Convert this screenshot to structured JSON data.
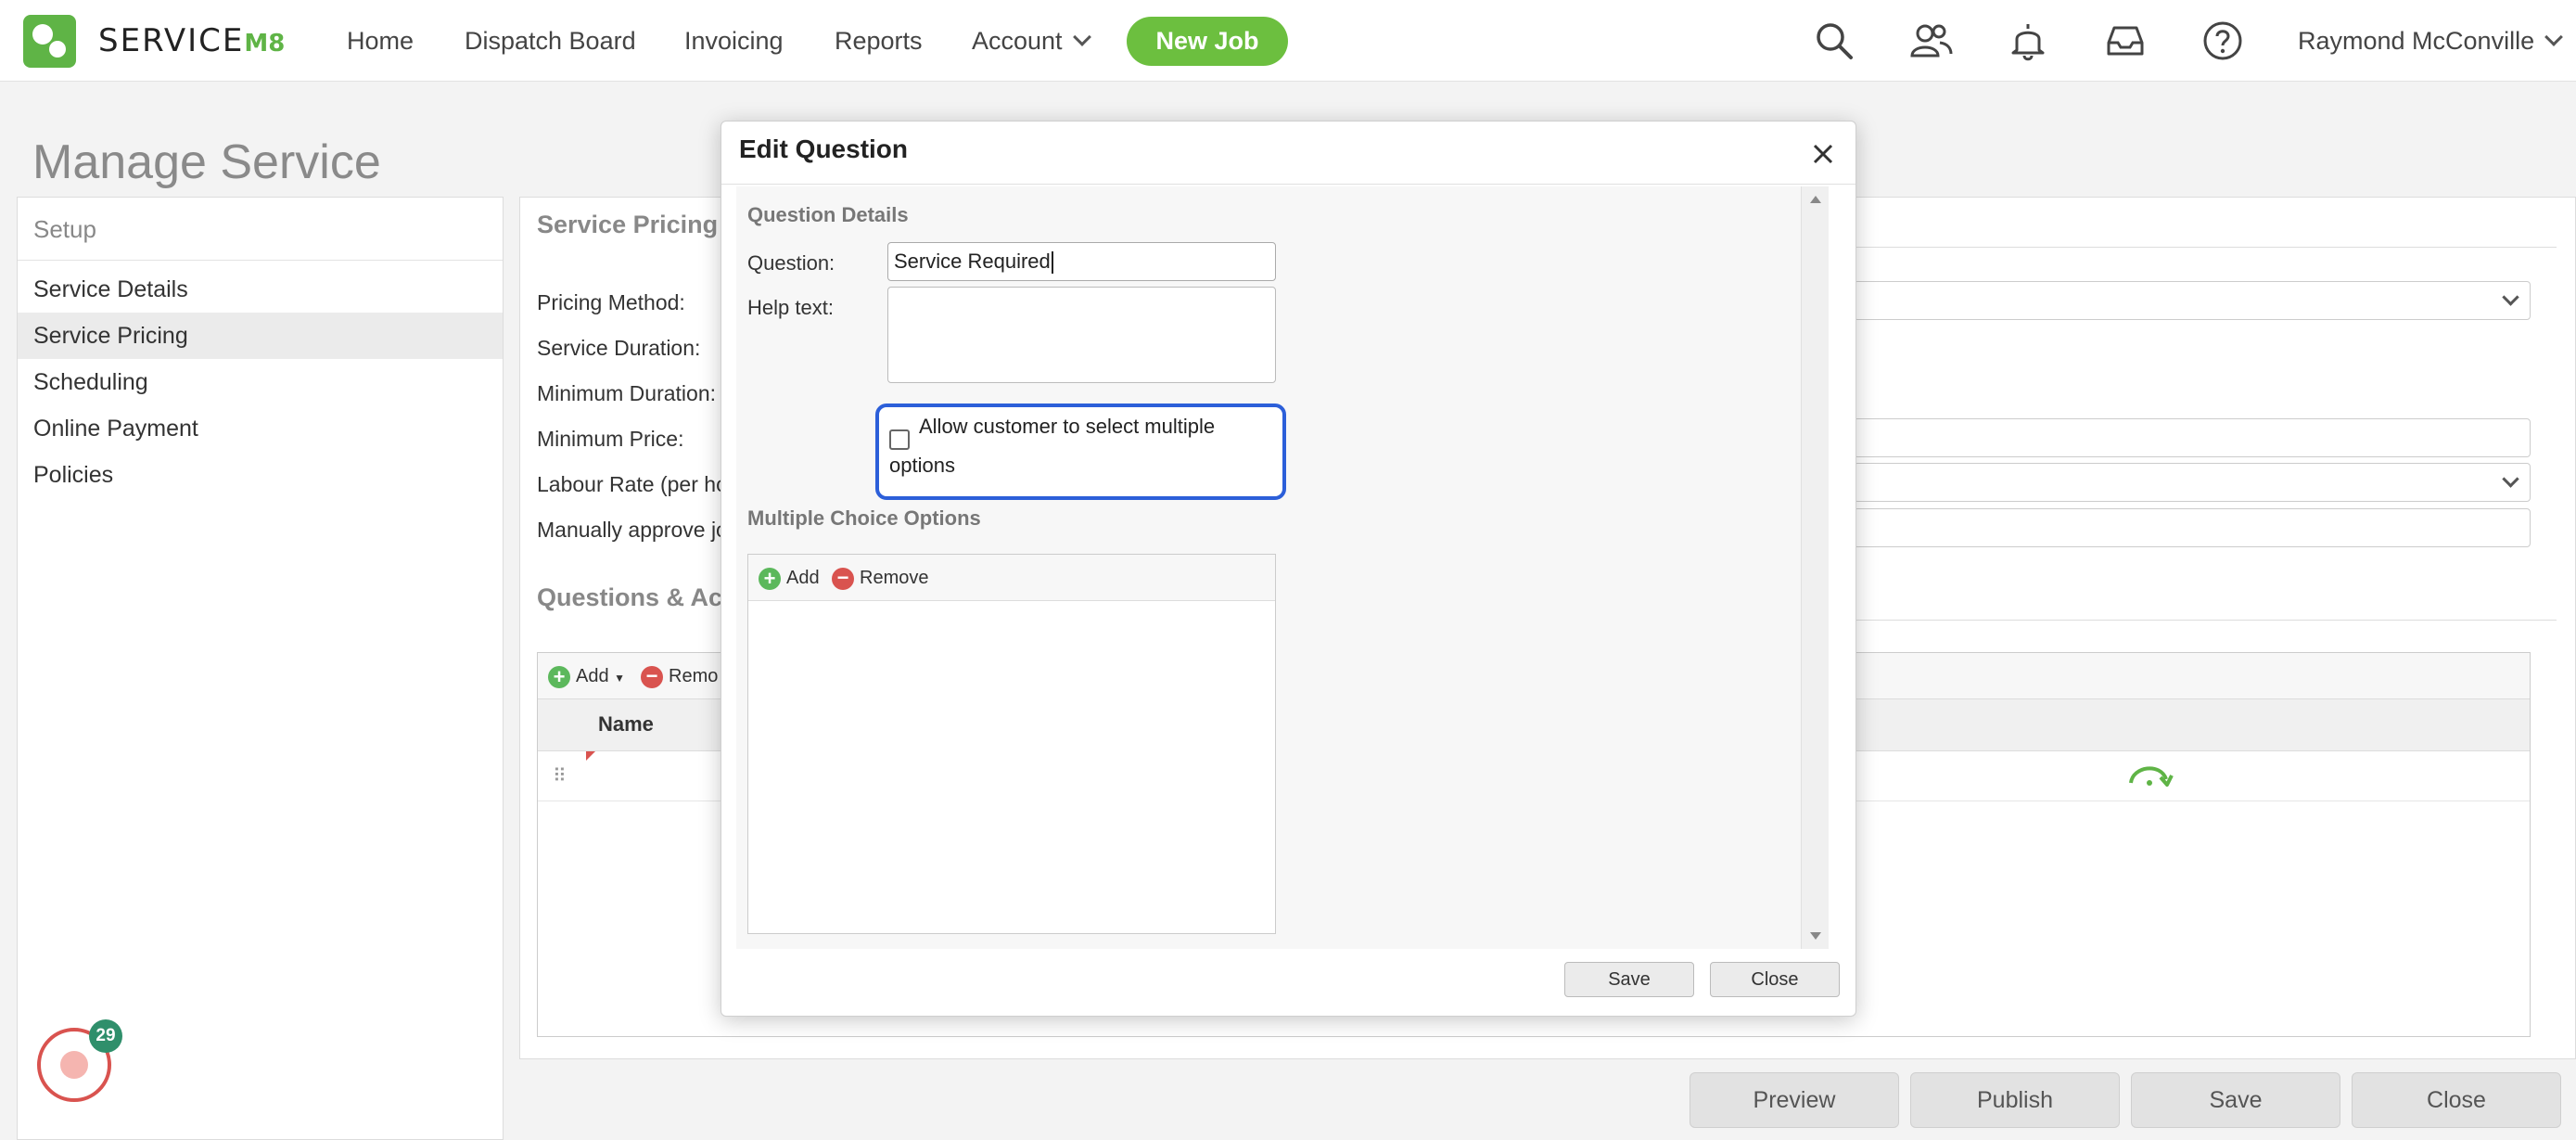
{
  "brand": {
    "name_main": "SERVICE",
    "name_suffix": "M8",
    "accent": "#6cbf3f"
  },
  "nav": {
    "items": [
      "Home",
      "Dispatch Board",
      "Invoicing",
      "Reports",
      "Account"
    ],
    "new_job": "New Job",
    "user": "Raymond McConville",
    "icons": [
      "search-icon",
      "people-icon",
      "bell-icon",
      "inbox-icon",
      "help-icon"
    ]
  },
  "page": {
    "title": "Manage Service"
  },
  "sidebar": {
    "heading": "Setup",
    "items": [
      "Service Details",
      "Service Pricing",
      "Scheduling",
      "Online Payment",
      "Policies"
    ],
    "active": "Service Pricing",
    "chat_badge": "29"
  },
  "main": {
    "section_title": "Service Pricing",
    "labels": [
      "Pricing Method:",
      "Service Duration:",
      "Minimum Duration:",
      "Minimum Price:",
      "Labour Rate (per hou",
      "Manually approve jo"
    ],
    "qa_title": "Questions & Acti",
    "qa_add": "Add",
    "qa_remove": "Remo",
    "qa_col_name": "Name"
  },
  "bottom": {
    "buttons": [
      "Preview",
      "Publish",
      "Save",
      "Close"
    ]
  },
  "modal": {
    "title": "Edit Question",
    "details_title": "Question Details",
    "question_label": "Question:",
    "question_value": "Service Required",
    "help_label": "Help text:",
    "help_value": "",
    "multi_label": "Allow customer to select multiple options",
    "multi_checked": false,
    "mc_title": "Multiple Choice Options",
    "mc_add": "Add",
    "mc_remove": "Remove",
    "save": "Save",
    "close": "Close"
  }
}
